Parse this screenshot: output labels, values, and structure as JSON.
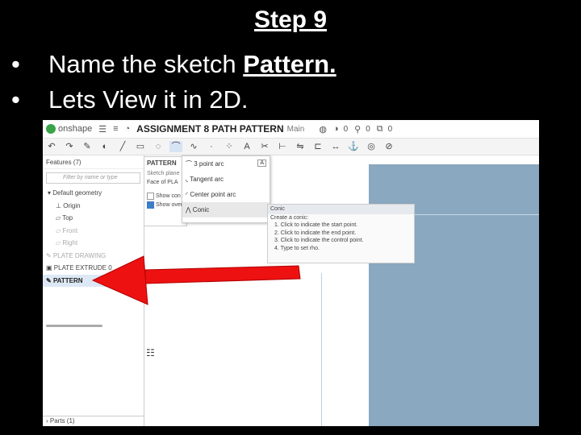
{
  "slide": {
    "title": "Step 9",
    "bullets": [
      {
        "text": "Name the sketch ",
        "bold": "Pattern."
      },
      {
        "text": "Lets View it in 2D.",
        "bold": ""
      }
    ]
  },
  "app": {
    "logo": "onshape",
    "doc_title": "ASSIGNMENT 8 PATH PATTERN",
    "branch": "Main",
    "count1": "0",
    "count2": "0",
    "count3": "0"
  },
  "toolbar_icons": [
    "undo-icon",
    "redo-icon",
    "sketch-icon",
    "fillet-icon",
    "line-icon",
    "rect-icon",
    "circle-icon",
    "arc-icon",
    "spline-icon",
    "point-icon",
    "construction-icon",
    "text-icon",
    "trim-icon",
    "extend-icon",
    "mirror-icon",
    "offset-icon",
    "dimension-icon",
    "fix-icon",
    "coincident-icon",
    "tangent-icon"
  ],
  "sidebar": {
    "header": "Features (7)",
    "filter_placeholder": "Filter by name or type",
    "group": "Default geometry",
    "planes": [
      {
        "label": "Origin",
        "dim": false
      },
      {
        "label": "Top",
        "dim": false
      },
      {
        "label": "Front",
        "dim": true
      },
      {
        "label": "Right",
        "dim": true
      }
    ],
    "features": [
      {
        "label": "PLATE DRAWING",
        "dim": true,
        "sel": false
      },
      {
        "label": "PLATE EXTRUDE 0",
        "dim": false,
        "sel": false
      },
      {
        "label": "PATTERN",
        "dim": false,
        "sel": true
      }
    ],
    "footer": "Parts (1)"
  },
  "dialog": {
    "title": "PATTERN",
    "plane_label": "Sketch plane",
    "plane_value": "Face of PLA",
    "opt1": "Show con",
    "opt2": "Show over"
  },
  "arc_menu": {
    "items": [
      "3 point arc",
      "Tangent arc",
      "Center point arc",
      "Conic"
    ],
    "highlighted": 3,
    "badge": "A"
  },
  "tooltip": {
    "title": "Conic",
    "lines": [
      "Create a conic:",
      "1. Click to indicate the start point.",
      "2. Click to indicate the end point.",
      "3. Click to indicate the control point.",
      "4. Type to set rho."
    ]
  },
  "colors": {
    "arrow": "#ee1111",
    "viewport": "#8aa8bf",
    "selection": "#dce8f5"
  }
}
